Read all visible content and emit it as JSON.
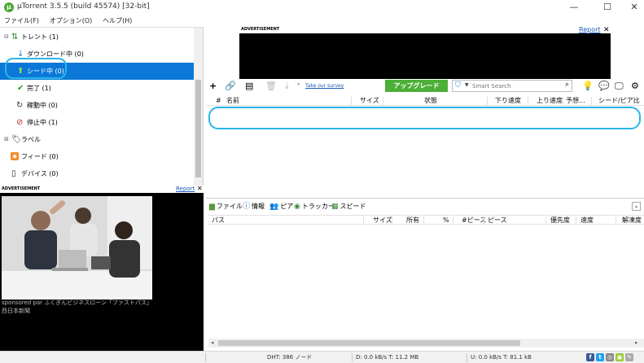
{
  "window": {
    "title": "µTorrent 3.5.5  (build 45574) [32-bit]",
    "minimize": "—",
    "maximize": "☐",
    "close": "✕"
  },
  "menu": [
    "ファイル(F)",
    "オプション(O)",
    "ヘルプ(H)"
  ],
  "sidebar": {
    "items": [
      {
        "label": "トレント",
        "count": "(1)",
        "icon": "torrents-icon"
      },
      {
        "label": "ダウンロード中",
        "count": "(0)",
        "icon": "download-arrow-icon"
      },
      {
        "label": "シード中",
        "count": "(0)",
        "icon": "seed-up-arrow-icon"
      },
      {
        "label": "完了",
        "count": "(1)",
        "icon": "checkmark-icon"
      },
      {
        "label": "稼動中",
        "count": "(0)",
        "icon": "refresh-icon"
      },
      {
        "label": "停止中",
        "count": "(1)",
        "icon": "stopped-icon"
      },
      {
        "label": "ラベル",
        "count": "",
        "icon": "tag-icon"
      },
      {
        "label": "フィード",
        "count": "(0)",
        "icon": "rss-icon"
      },
      {
        "label": "デバイス",
        "count": "(0)",
        "icon": "device-icon"
      }
    ]
  },
  "left_ad": {
    "label": "ADVERTISEMENT",
    "report": "Report",
    "close": "✕",
    "sponsor_text": "sponsored par ふくぎんビジネスローン「ファストパス」\n西日本新聞"
  },
  "top_ad": {
    "label": "ADVERTISEMENT",
    "report": "Report",
    "close": "✕"
  },
  "toolbar": {
    "survey_link": "Take our survey",
    "upgrade_label": "アップグレード",
    "search_placeholder": "Smart Search"
  },
  "torrent_columns": [
    "#",
    "名前",
    "サイズ",
    "状態",
    "下り速度",
    "上り速度",
    "予想...",
    "シード/ピア比"
  ],
  "detail_tabs": [
    {
      "label": "ファイル",
      "icon": "folder-icon"
    },
    {
      "label": "情報",
      "icon": "info-icon"
    },
    {
      "label": "ピア",
      "icon": "peers-icon"
    },
    {
      "label": "トラッカー",
      "icon": "tracker-icon"
    },
    {
      "label": "スピード",
      "icon": "speed-graph-icon"
    }
  ],
  "file_columns": [
    "パス",
    "サイズ",
    "所有",
    "%",
    "#ピース",
    "ピース",
    "優先度",
    "速度",
    "解凍度"
  ],
  "status": {
    "dht": "DHT: 386 ノード",
    "download": "D: 0.0 kB/s T: 11.2 MB",
    "upload": "U: 0.0 kB/s T: 81.1 kB"
  },
  "colors": {
    "selection": "#0b78d7",
    "upgrade": "#4caf38",
    "highlight_ring": "#29b6e9",
    "link": "#1a5bb8"
  }
}
